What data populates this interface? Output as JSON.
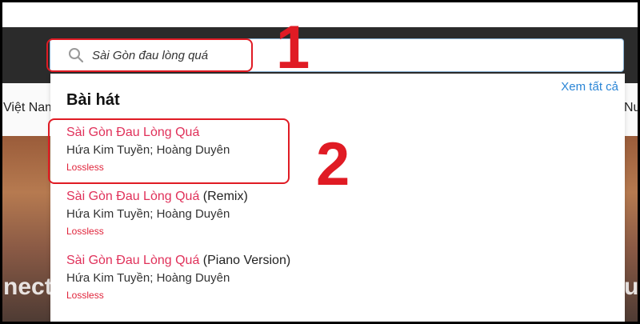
{
  "search": {
    "query": "Sài Gòn đau lòng quá"
  },
  "nav": {
    "left_text": "Việt Nam",
    "right_text": "Nu"
  },
  "hero": {
    "left_text": "nection",
    "right_text": "ut"
  },
  "dropdown": {
    "section_title": "Bài hát",
    "see_all_label": "Xem tất cả",
    "results": [
      {
        "title": "Sài Gòn Đau Lòng Quá",
        "suffix": "",
        "artist": "Hứa Kim Tuyền; Hoàng Duyên",
        "badge": "Lossless"
      },
      {
        "title": "Sài Gòn Đau Lòng Quá",
        "suffix": " (Remix)",
        "artist": "Hứa Kim Tuyền; Hoàng Duyên",
        "badge": "Lossless"
      },
      {
        "title": "Sài Gòn Đau Lòng Quá",
        "suffix": " (Piano Version)",
        "artist": "Hứa Kim Tuyền; Hoàng Duyên",
        "badge": "Lossless"
      }
    ]
  },
  "annotations": {
    "step1": "1",
    "step2": "2"
  },
  "colors": {
    "accent": "#e0315a",
    "link": "#2a85d6",
    "annotation": "#e01b24",
    "header": "#2b2b2b"
  }
}
